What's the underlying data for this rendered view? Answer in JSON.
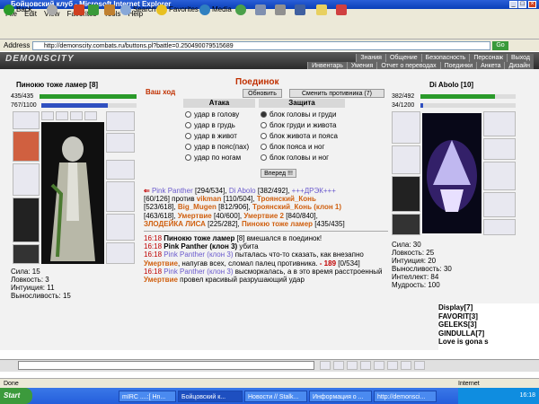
{
  "window": {
    "title": "Бойцовский клуб - Microsoft Internet Explorer"
  },
  "menu": [
    "File",
    "Edit",
    "View",
    "Favorites",
    "Tools",
    "Help"
  ],
  "toolbar": {
    "back": "Back",
    "search": "Search",
    "favorites": "Favorites",
    "media": "Media"
  },
  "address": {
    "label": "Address",
    "url": "http://demonscity.combats.ru/buttons.pl?battle=0.250490079515689"
  },
  "game": {
    "logo": "DEMONSCITY",
    "nav_top": [
      "Знания",
      "Общение",
      "Безопасность",
      "Персонаж",
      "Выход"
    ],
    "nav_bottom": [
      "Инвентарь",
      "Умения",
      "Отчет о переводах",
      "Поединки",
      "Анкета",
      "Дизайн"
    ]
  },
  "left_player": {
    "name": "Пинокю тоже ламер",
    "level": "[8]",
    "hp": "435/435",
    "mana": "767/1100",
    "hp_frac": 1.0,
    "mana_frac": 0.7,
    "stats": [
      "Сила: 15",
      "Ловкость: 3",
      "Интуиция: 11",
      "Выносливость: 15"
    ]
  },
  "right_player": {
    "name": "Di Abolo",
    "level": "[10]",
    "hp": "382/492",
    "mana": "34/1200",
    "hp_frac": 0.78,
    "mana_frac": 0.03,
    "stats": [
      "Сила: 30",
      "Ловкость: 25",
      "Интуиция: 20",
      "Выносливость: 30",
      "Интеллект: 84",
      "Мудрость: 100"
    ]
  },
  "duel": {
    "title": "Поединок",
    "your_move": "Ваш ход",
    "refresh": "Обновить",
    "change_opponent": "Сменить противника (7)",
    "attack_header": "Атака",
    "defense_header": "Защита",
    "attacks": [
      "удар в голову",
      "удар в грудь",
      "удар в живот",
      "удар в пояс(пах)",
      "удар по ногам"
    ],
    "defenses": [
      "блок головы и груди",
      "блок груди и живота",
      "блок живота и пояса",
      "блок пояса и ног",
      "блок головы и ног"
    ],
    "forward": "Вперед !!!"
  },
  "teams": {
    "line1a": "Pink Panther",
    "line1b": "[294/534],",
    "line1c": "Di Abolo",
    "line1d": "[382/492],",
    "line1e": "+++ДРЭК+++",
    "line2": "[60/126] против",
    "line2a": "vikman",
    "line2b": "[110/504],",
    "line2c": "Троянский_Конь",
    "line3a": "[523/618],",
    "line3b": "Big_Mugen",
    "line3c": "[812/906],",
    "line3d": "Троянский_Конь (клон 1)",
    "line4a": "[463/618],",
    "line4b": "Умертвие",
    "line4c": "[40/600],",
    "line4d": "Умертвие 2",
    "line4e": "[840/840],",
    "line5a": "ЗЛОДЕЙКА ЛИСА",
    "line5b": "[225/282],",
    "line5c": "Пинокю тоже ламер",
    "line5d": "[435/435]"
  },
  "log": [
    {
      "time": "16:18",
      "who": "Пинокю тоже ламер",
      "lvl": "[8]",
      "text": "вмешался в поединок!"
    },
    {
      "time": "16:18",
      "who": "Pink Panther (клон 3)",
      "text": "убита"
    },
    {
      "time": "16:18",
      "who": "Pink Panther (клон 3)",
      "text": "пыталась что-то сказать, как внезапно",
      "who2": "Умертвие",
      "text2": ", напугав всех, сломал палец противника.",
      "dmg": "- 189",
      "hp": "[0/534]"
    },
    {
      "time": "16:18",
      "who": "Pink Panther (клон 3)",
      "text": "высморкалась, а в это время расстроенный",
      "who2": "Умертвие",
      "text2": "провел красивый разрушающий удар"
    }
  ],
  "chat": [
    "Display[7]",
    "FAVORIT[3]",
    "GELEKS[3]",
    "GINDULLA[7]",
    "Love is gona s"
  ],
  "status": {
    "left": "Done",
    "right": "Internet"
  },
  "taskbar": {
    "start": "Start",
    "tasks": [
      "mIRC ....:[ Hn...",
      "Бойцовский к...",
      "Новости // Stalk...",
      "Информация о ...",
      "http://demonsci..."
    ],
    "clock": "16:18"
  },
  "colors": {
    "hp": "#2a9a2a",
    "mana": "#3050c0",
    "accent": "#c03000"
  }
}
